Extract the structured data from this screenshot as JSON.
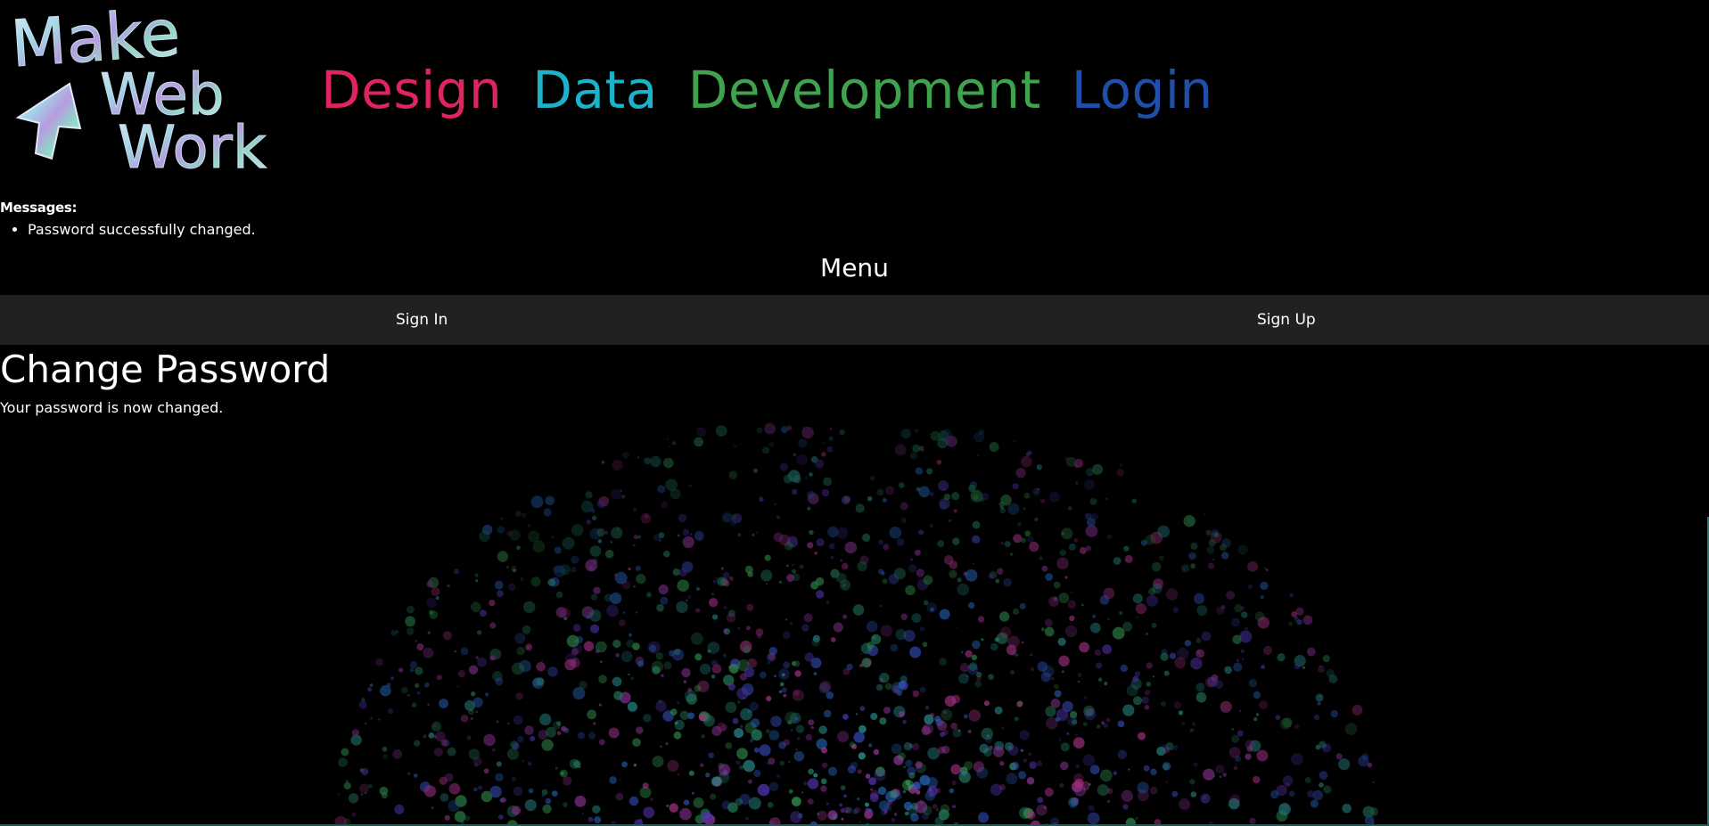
{
  "logo": {
    "alt": "Make Web Work",
    "word1": "Make",
    "word2": "Web",
    "word3": "Work"
  },
  "nav": {
    "items": [
      {
        "label": "Design",
        "color": "#e0245e"
      },
      {
        "label": "Data",
        "color": "#1ab3c9"
      },
      {
        "label": "Development",
        "color": "#3fa34d"
      },
      {
        "label": "Login",
        "color": "#1f4fa8"
      }
    ]
  },
  "messages": {
    "title": "Messages:",
    "items": [
      "Password successfully changed."
    ]
  },
  "menu": {
    "title": "Menu",
    "items": [
      {
        "label": "Sign In"
      },
      {
        "label": "Sign Up"
      }
    ]
  },
  "content": {
    "title": "Change Password",
    "text": "Your password is now changed."
  }
}
